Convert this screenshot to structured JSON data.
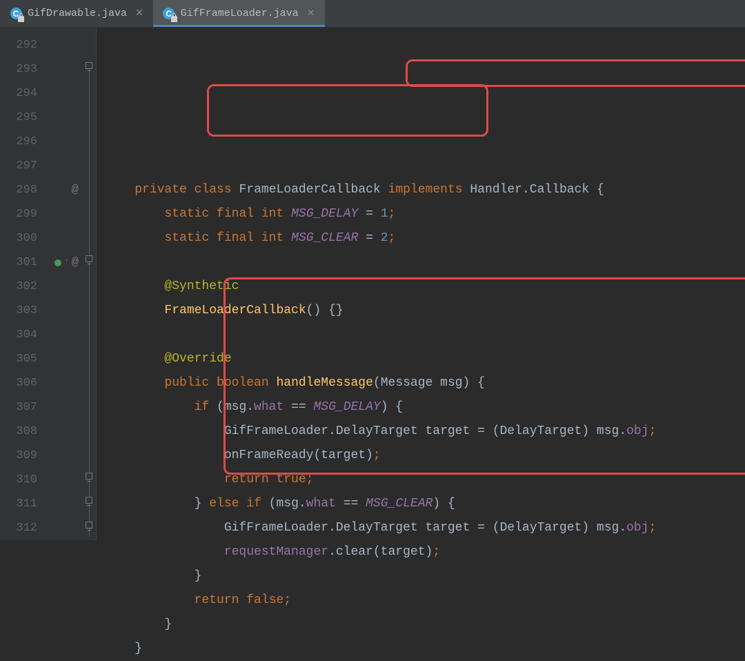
{
  "tabs": [
    {
      "label": "GifDrawable.java",
      "active": false
    },
    {
      "label": "GifFrameLoader.java",
      "active": true
    }
  ],
  "lines": [
    {
      "num": "292",
      "marker": "",
      "tokens": []
    },
    {
      "num": "293",
      "marker": "",
      "indent": 2,
      "tokens": [
        {
          "cls": "kw",
          "t": "private"
        },
        {
          "cls": "plain",
          "t": " "
        },
        {
          "cls": "kw",
          "t": "class"
        },
        {
          "cls": "plain",
          "t": " "
        },
        {
          "cls": "type",
          "t": "FrameLoaderCallback"
        },
        {
          "cls": "plain",
          "t": " "
        },
        {
          "cls": "kw",
          "t": "implements"
        },
        {
          "cls": "plain",
          "t": " "
        },
        {
          "cls": "type",
          "t": "Handler.Callback"
        },
        {
          "cls": "plain",
          "t": " {"
        }
      ]
    },
    {
      "num": "294",
      "marker": "",
      "indent": 4,
      "tokens": [
        {
          "cls": "kw",
          "t": "static"
        },
        {
          "cls": "plain",
          "t": " "
        },
        {
          "cls": "kw",
          "t": "final"
        },
        {
          "cls": "plain",
          "t": " "
        },
        {
          "cls": "kw",
          "t": "int"
        },
        {
          "cls": "plain",
          "t": " "
        },
        {
          "cls": "field-italic",
          "t": "MSG_DELAY"
        },
        {
          "cls": "plain",
          "t": " = "
        },
        {
          "cls": "num",
          "t": "1"
        },
        {
          "cls": "punct",
          "t": ";"
        }
      ]
    },
    {
      "num": "295",
      "marker": "",
      "indent": 4,
      "tokens": [
        {
          "cls": "kw",
          "t": "static"
        },
        {
          "cls": "plain",
          "t": " "
        },
        {
          "cls": "kw",
          "t": "final"
        },
        {
          "cls": "plain",
          "t": " "
        },
        {
          "cls": "kw",
          "t": "int"
        },
        {
          "cls": "plain",
          "t": " "
        },
        {
          "cls": "field-italic",
          "t": "MSG_CLEAR"
        },
        {
          "cls": "plain",
          "t": " = "
        },
        {
          "cls": "num",
          "t": "2"
        },
        {
          "cls": "punct",
          "t": ";"
        }
      ]
    },
    {
      "num": "296",
      "marker": "",
      "tokens": []
    },
    {
      "num": "297",
      "marker": "",
      "indent": 4,
      "tokens": [
        {
          "cls": "ann",
          "t": "@Synthetic"
        }
      ]
    },
    {
      "num": "298",
      "marker": "at",
      "indent": 4,
      "tokens": [
        {
          "cls": "method",
          "t": "FrameLoaderCallback"
        },
        {
          "cls": "plain",
          "t": "() {}"
        }
      ]
    },
    {
      "num": "299",
      "marker": "",
      "tokens": []
    },
    {
      "num": "300",
      "marker": "",
      "indent": 4,
      "tokens": [
        {
          "cls": "ann",
          "t": "@Override"
        }
      ]
    },
    {
      "num": "301",
      "marker": "override-at",
      "indent": 4,
      "tokens": [
        {
          "cls": "kw",
          "t": "public"
        },
        {
          "cls": "plain",
          "t": " "
        },
        {
          "cls": "kw",
          "t": "boolean"
        },
        {
          "cls": "plain",
          "t": " "
        },
        {
          "cls": "method",
          "t": "handleMessage"
        },
        {
          "cls": "plain",
          "t": "(Message msg) {"
        }
      ]
    },
    {
      "num": "302",
      "marker": "",
      "indent": 6,
      "tokens": [
        {
          "cls": "kw",
          "t": "if"
        },
        {
          "cls": "plain",
          "t": " (msg."
        },
        {
          "cls": "field",
          "t": "what"
        },
        {
          "cls": "plain",
          "t": " == "
        },
        {
          "cls": "field-italic",
          "t": "MSG_DELAY"
        },
        {
          "cls": "plain",
          "t": ") {"
        }
      ]
    },
    {
      "num": "303",
      "marker": "",
      "indent": 8,
      "tokens": [
        {
          "cls": "plain",
          "t": "GifFrameLoader.DelayTarget target = (DelayTarget) msg."
        },
        {
          "cls": "field",
          "t": "obj"
        },
        {
          "cls": "punct",
          "t": ";"
        }
      ]
    },
    {
      "num": "304",
      "marker": "",
      "indent": 8,
      "tokens": [
        {
          "cls": "plain",
          "t": "onFrameReady(target)"
        },
        {
          "cls": "punct",
          "t": ";"
        }
      ]
    },
    {
      "num": "305",
      "marker": "",
      "indent": 8,
      "tokens": [
        {
          "cls": "kw",
          "t": "return"
        },
        {
          "cls": "plain",
          "t": " "
        },
        {
          "cls": "kw",
          "t": "true"
        },
        {
          "cls": "punct",
          "t": ";"
        }
      ]
    },
    {
      "num": "306",
      "marker": "",
      "indent": 6,
      "tokens": [
        {
          "cls": "plain",
          "t": "} "
        },
        {
          "cls": "kw",
          "t": "else"
        },
        {
          "cls": "plain",
          "t": " "
        },
        {
          "cls": "kw",
          "t": "if"
        },
        {
          "cls": "plain",
          "t": " (msg."
        },
        {
          "cls": "field",
          "t": "what"
        },
        {
          "cls": "plain",
          "t": " == "
        },
        {
          "cls": "field-italic",
          "t": "MSG_CLEAR"
        },
        {
          "cls": "plain",
          "t": ") {"
        }
      ]
    },
    {
      "num": "307",
      "marker": "",
      "indent": 8,
      "tokens": [
        {
          "cls": "plain",
          "t": "GifFrameLoader.DelayTarget target = (DelayTarget) msg."
        },
        {
          "cls": "field",
          "t": "obj"
        },
        {
          "cls": "punct",
          "t": ";"
        }
      ]
    },
    {
      "num": "308",
      "marker": "",
      "indent": 8,
      "tokens": [
        {
          "cls": "field",
          "t": "requestManager"
        },
        {
          "cls": "plain",
          "t": ".clear(target)"
        },
        {
          "cls": "punct",
          "t": ";"
        }
      ]
    },
    {
      "num": "309",
      "marker": "",
      "indent": 6,
      "tokens": [
        {
          "cls": "plain",
          "t": "}"
        }
      ]
    },
    {
      "num": "310",
      "marker": "",
      "indent": 6,
      "tokens": [
        {
          "cls": "kw",
          "t": "return"
        },
        {
          "cls": "plain",
          "t": " "
        },
        {
          "cls": "kw",
          "t": "false"
        },
        {
          "cls": "punct",
          "t": ";"
        }
      ]
    },
    {
      "num": "311",
      "marker": "",
      "indent": 4,
      "tokens": [
        {
          "cls": "plain",
          "t": "}"
        }
      ]
    },
    {
      "num": "312",
      "marker": "",
      "indent": 2,
      "tokens": [
        {
          "cls": "plain",
          "t": "}"
        }
      ]
    }
  ],
  "highlights": [
    {
      "id": "implements-clause",
      "box": "hl1"
    },
    {
      "id": "msg-constants",
      "box": "hl2"
    },
    {
      "id": "if-else-block",
      "box": "hl3"
    }
  ],
  "fold": {
    "lineStartPx": 50,
    "lineEndPx": 738,
    "handles": [
      50,
      330,
      645,
      680,
      716
    ]
  }
}
